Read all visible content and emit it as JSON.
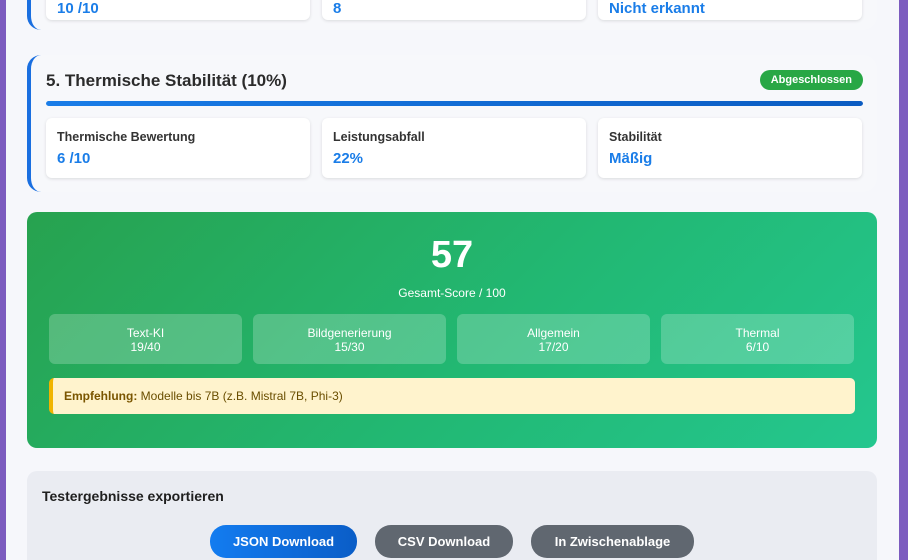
{
  "previous_section": {
    "metrics": [
      {
        "value": "10 /10"
      },
      {
        "value": "8"
      },
      {
        "value": "Nicht erkannt"
      }
    ]
  },
  "thermal": {
    "title": "5. Thermische Stabilität (10%)",
    "status": "Abgeschlossen",
    "progress": 1.0,
    "metrics": [
      {
        "label": "Thermische Bewertung",
        "value": "6 /10"
      },
      {
        "label": "Leistungsabfall",
        "value": "22%"
      },
      {
        "label": "Stabilität",
        "value": "Mäßig"
      }
    ]
  },
  "score": {
    "value": "57",
    "caption": "Gesamt-Score / 100",
    "breakdown": [
      {
        "label": "Text-KI",
        "value": "19/40"
      },
      {
        "label": "Bildgenerierung",
        "value": "15/30"
      },
      {
        "label": "Allgemein",
        "value": "17/20"
      },
      {
        "label": "Thermal",
        "value": "6/10"
      }
    ],
    "recommendation_label": "Empfehlung:",
    "recommendation_text": "Modelle bis 7B (z.B. Mistral 7B, Phi-3)"
  },
  "export": {
    "title": "Testergebnisse exportieren",
    "json_label": "JSON Download",
    "csv_label": "CSV Download",
    "clipboard_label": "In Zwischenablage"
  },
  "colors": {
    "accent": "#1a7de8",
    "success": "#28a745",
    "warning_bg": "#fff3cd"
  }
}
